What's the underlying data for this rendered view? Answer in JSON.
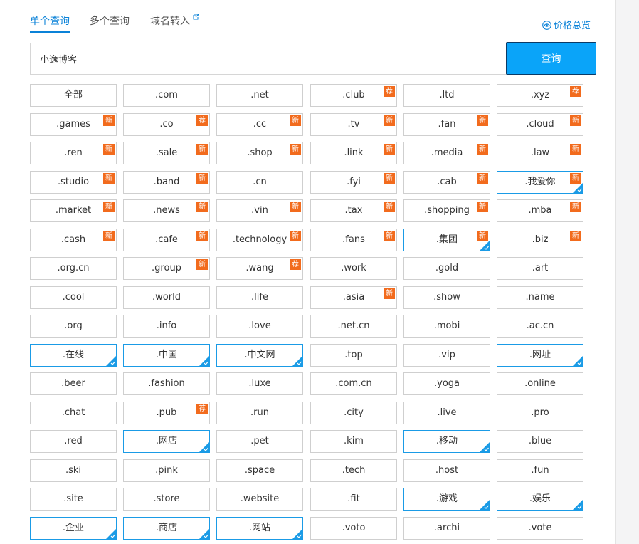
{
  "tabs": [
    {
      "label": "单个查询",
      "active": true
    },
    {
      "label": "多个查询",
      "active": false
    },
    {
      "label": "域名转入",
      "active": false,
      "external": true
    }
  ],
  "price_overview": {
    "label": "价格总览"
  },
  "search": {
    "value": "小逸博客",
    "button_label": "查询"
  },
  "badge_labels": {
    "new": "新",
    "recommended": "荐"
  },
  "colors": {
    "accent": "#0a82d8",
    "button": "#0aa4f9",
    "badge": "#f26b1d",
    "selected_border": "#1a9be6"
  },
  "suffixes": [
    {
      "label": "全部"
    },
    {
      "label": ".com"
    },
    {
      "label": ".net"
    },
    {
      "label": ".club",
      "badge": "荐"
    },
    {
      "label": ".ltd"
    },
    {
      "label": ".xyz",
      "badge": "荐"
    },
    {
      "label": ".games",
      "badge": "新"
    },
    {
      "label": ".co",
      "badge": "荐"
    },
    {
      "label": ".cc",
      "badge": "新"
    },
    {
      "label": ".tv",
      "badge": "新"
    },
    {
      "label": ".fan",
      "badge": "新"
    },
    {
      "label": ".cloud",
      "badge": "新"
    },
    {
      "label": ".ren",
      "badge": "新"
    },
    {
      "label": ".sale",
      "badge": "新"
    },
    {
      "label": ".shop",
      "badge": "新"
    },
    {
      "label": ".link",
      "badge": "新"
    },
    {
      "label": ".media",
      "badge": "新"
    },
    {
      "label": ".law",
      "badge": "新"
    },
    {
      "label": ".studio",
      "badge": "新"
    },
    {
      "label": ".band",
      "badge": "新"
    },
    {
      "label": ".cn"
    },
    {
      "label": ".fyi",
      "badge": "新"
    },
    {
      "label": ".cab",
      "badge": "新"
    },
    {
      "label": ".我爱你",
      "badge": "新",
      "selected": true
    },
    {
      "label": ".market",
      "badge": "新"
    },
    {
      "label": ".news",
      "badge": "新"
    },
    {
      "label": ".vin",
      "badge": "新"
    },
    {
      "label": ".tax",
      "badge": "新"
    },
    {
      "label": ".shopping",
      "badge": "新"
    },
    {
      "label": ".mba",
      "badge": "新"
    },
    {
      "label": ".cash",
      "badge": "新"
    },
    {
      "label": ".cafe",
      "badge": "新"
    },
    {
      "label": ".technology",
      "badge": "新"
    },
    {
      "label": ".fans",
      "badge": "新"
    },
    {
      "label": ".集团",
      "badge": "新",
      "selected": true
    },
    {
      "label": ".biz",
      "badge": "新"
    },
    {
      "label": ".org.cn"
    },
    {
      "label": ".group",
      "badge": "新"
    },
    {
      "label": ".wang",
      "badge": "荐"
    },
    {
      "label": ".work"
    },
    {
      "label": ".gold"
    },
    {
      "label": ".art"
    },
    {
      "label": ".cool"
    },
    {
      "label": ".world"
    },
    {
      "label": ".life"
    },
    {
      "label": ".asia",
      "badge": "新"
    },
    {
      "label": ".show"
    },
    {
      "label": ".name"
    },
    {
      "label": ".org"
    },
    {
      "label": ".info"
    },
    {
      "label": ".love"
    },
    {
      "label": ".net.cn"
    },
    {
      "label": ".mobi"
    },
    {
      "label": ".ac.cn"
    },
    {
      "label": ".在线",
      "selected": true
    },
    {
      "label": ".中国",
      "selected": true
    },
    {
      "label": ".中文网",
      "selected": true
    },
    {
      "label": ".top"
    },
    {
      "label": ".vip"
    },
    {
      "label": ".网址",
      "selected": true
    },
    {
      "label": ".beer"
    },
    {
      "label": ".fashion"
    },
    {
      "label": ".luxe"
    },
    {
      "label": ".com.cn"
    },
    {
      "label": ".yoga"
    },
    {
      "label": ".online"
    },
    {
      "label": ".chat"
    },
    {
      "label": ".pub",
      "badge": "荐"
    },
    {
      "label": ".run"
    },
    {
      "label": ".city"
    },
    {
      "label": ".live"
    },
    {
      "label": ".pro"
    },
    {
      "label": ".red"
    },
    {
      "label": ".网店",
      "selected": true
    },
    {
      "label": ".pet"
    },
    {
      "label": ".kim"
    },
    {
      "label": ".移动",
      "selected": true
    },
    {
      "label": ".blue"
    },
    {
      "label": ".ski"
    },
    {
      "label": ".pink"
    },
    {
      "label": ".space"
    },
    {
      "label": ".tech"
    },
    {
      "label": ".host"
    },
    {
      "label": ".fun"
    },
    {
      "label": ".site"
    },
    {
      "label": ".store"
    },
    {
      "label": ".website"
    },
    {
      "label": ".fit"
    },
    {
      "label": ".游戏",
      "selected": true
    },
    {
      "label": ".娱乐",
      "selected": true
    },
    {
      "label": ".企业",
      "selected": true
    },
    {
      "label": ".商店",
      "selected": true
    },
    {
      "label": ".网站",
      "selected": true
    },
    {
      "label": ".voto"
    },
    {
      "label": ".archi"
    },
    {
      "label": ".vote"
    }
  ]
}
